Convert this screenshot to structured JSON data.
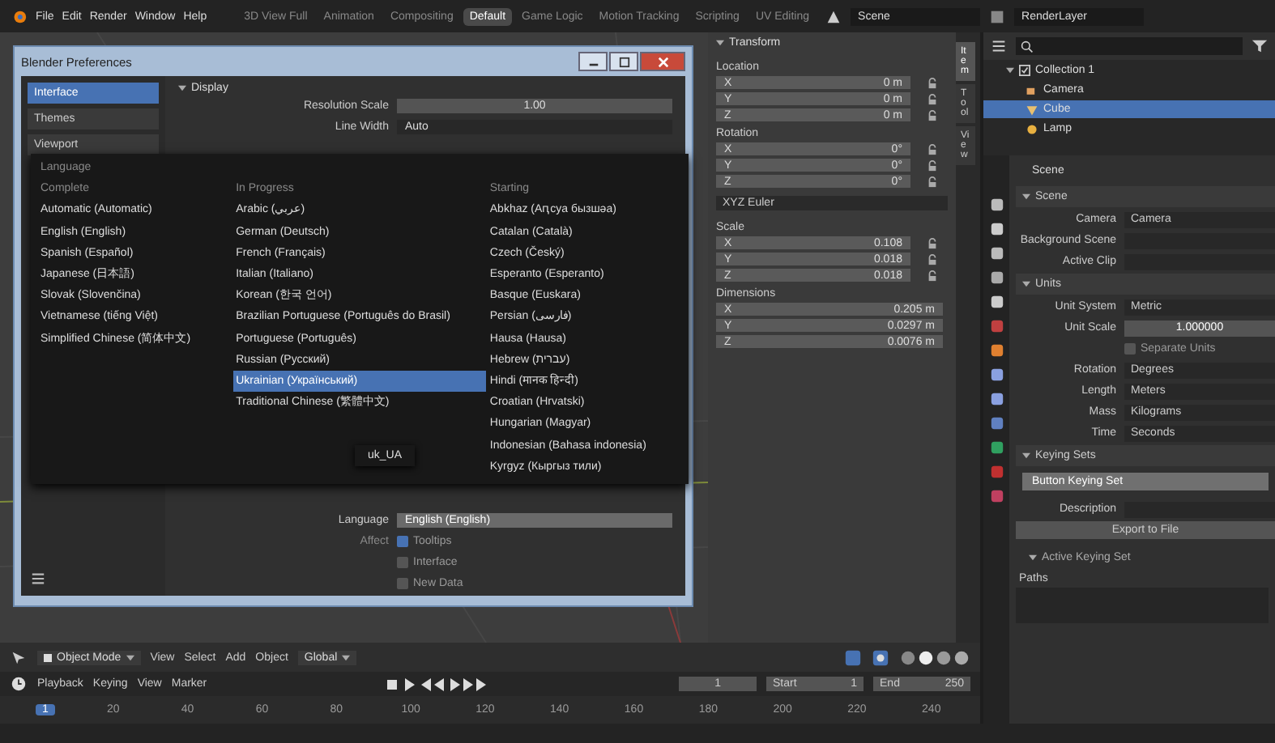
{
  "topbar": {
    "menus": [
      "File",
      "Edit",
      "Render",
      "Window",
      "Help"
    ],
    "workspaces": [
      {
        "label": "3D View Full",
        "selected": false
      },
      {
        "label": "Animation",
        "selected": false
      },
      {
        "label": "Compositing",
        "selected": false
      },
      {
        "label": "Default",
        "selected": true
      },
      {
        "label": "Game Logic",
        "selected": false
      },
      {
        "label": "Motion Tracking",
        "selected": false
      },
      {
        "label": "Scripting",
        "selected": false
      },
      {
        "label": "UV Editing",
        "selected": false
      }
    ],
    "scene": "Scene",
    "view_layer": "RenderLayer"
  },
  "preferences": {
    "title": "Blender Preferences",
    "sidebar": [
      {
        "label": "Interface",
        "selected": true
      },
      {
        "label": "Themes",
        "selected": false
      },
      {
        "label": "Viewport",
        "selected": false
      }
    ],
    "display": {
      "header": "Display",
      "fields": [
        {
          "label": "Resolution Scale",
          "value": "1.00",
          "kind": "number"
        },
        {
          "label": "Line Width",
          "value": "Auto",
          "kind": "dropdown"
        }
      ]
    },
    "language_menu": {
      "title": "Language",
      "columns": [
        {
          "heading": "Complete",
          "items": [
            {
              "label": "Automatic (Automatic)",
              "selected": false
            },
            {
              "label": "English (English)",
              "selected": false
            },
            {
              "label": "Spanish (Español)",
              "selected": false
            },
            {
              "label": "Japanese (日本語)",
              "selected": false
            },
            {
              "label": "Slovak (Slovenčina)",
              "selected": false
            },
            {
              "label": "Vietnamese (tiếng Việt)",
              "selected": false
            },
            {
              "label": "Simplified Chinese (简体中文)",
              "selected": false
            }
          ]
        },
        {
          "heading": "In Progress",
          "items": [
            {
              "label": "Arabic (عربي)",
              "selected": false
            },
            {
              "label": "German (Deutsch)",
              "selected": false
            },
            {
              "label": "French (Français)",
              "selected": false
            },
            {
              "label": "Italian (Italiano)",
              "selected": false
            },
            {
              "label": "Korean (한국 언어)",
              "selected": false
            },
            {
              "label": "Brazilian Portuguese (Português do Brasil)",
              "selected": false
            },
            {
              "label": "Portuguese (Português)",
              "selected": false
            },
            {
              "label": "Russian (Русский)",
              "selected": false
            },
            {
              "label": "Ukrainian (Український)",
              "selected": true
            },
            {
              "label": "Traditional Chinese (繁體中文)",
              "selected": false
            }
          ]
        },
        {
          "heading": "Starting",
          "items": [
            {
              "label": "Abkhaz (Аԥсуа бызшәа)",
              "selected": false
            },
            {
              "label": "Catalan (Català)",
              "selected": false
            },
            {
              "label": "Czech (Český)",
              "selected": false
            },
            {
              "label": "Esperanto (Esperanto)",
              "selected": false
            },
            {
              "label": "Basque (Euskara)",
              "selected": false
            },
            {
              "label": "Persian (فارسی)",
              "selected": false
            },
            {
              "label": "Hausa (Hausa)",
              "selected": false
            },
            {
              "label": "Hebrew (עברית)",
              "selected": false
            },
            {
              "label": "Hindi (मानक हिन्दी)",
              "selected": false
            },
            {
              "label": "Croatian (Hrvatski)",
              "selected": false
            },
            {
              "label": "Hungarian (Magyar)",
              "selected": false
            },
            {
              "label": "Indonesian (Bahasa indonesia)",
              "selected": false
            },
            {
              "label": "Kyrgyz (Кыргыз тили)",
              "selected": false
            }
          ]
        }
      ]
    },
    "tooltip": "uk_UA",
    "language": {
      "label": "Language",
      "value": "English (English)"
    },
    "affect": {
      "label": "Affect",
      "options": [
        {
          "label": "Tooltips",
          "checked": true
        },
        {
          "label": "Interface",
          "checked": false
        },
        {
          "label": "New Data",
          "checked": false
        }
      ]
    }
  },
  "sidebar_panel": {
    "title": "Transform",
    "tabs": [
      {
        "label": "Item",
        "selected": true
      },
      {
        "label": "Tool",
        "selected": false
      },
      {
        "label": "View",
        "selected": false
      }
    ],
    "groups": [
      {
        "kind": "vector",
        "label": "Location",
        "rows": [
          {
            "axis": "X",
            "value": "0 m"
          },
          {
            "axis": "Y",
            "value": "0 m"
          },
          {
            "axis": "Z",
            "value": "0 m"
          }
        ]
      },
      {
        "kind": "vector",
        "label": "Rotation",
        "rows": [
          {
            "axis": "X",
            "value": "0°"
          },
          {
            "axis": "Y",
            "value": "0°"
          },
          {
            "axis": "Z",
            "value": "0°"
          }
        ]
      },
      {
        "kind": "dropdown",
        "value": "XYZ Euler"
      },
      {
        "kind": "vector",
        "label": "Scale",
        "rows": [
          {
            "axis": "X",
            "value": "0.108"
          },
          {
            "axis": "Y",
            "value": "0.018"
          },
          {
            "axis": "Z",
            "value": "0.018"
          }
        ]
      },
      {
        "kind": "dimensions",
        "label": "Dimensions",
        "rows": [
          {
            "axis": "X",
            "value": "0.205 m"
          },
          {
            "axis": "Y",
            "value": "0.0297 m"
          },
          {
            "axis": "Z",
            "value": "0.0076 m"
          }
        ]
      }
    ]
  },
  "outliner": {
    "collection": "Collection 1",
    "items": [
      {
        "label": "Camera",
        "kind": "camera",
        "selected": false
      },
      {
        "label": "Cube",
        "kind": "mesh",
        "selected": true
      },
      {
        "label": "Lamp",
        "kind": "light",
        "selected": false
      }
    ]
  },
  "properties": {
    "context": "Scene",
    "panels": [
      {
        "title": "Scene",
        "rows": [
          {
            "kind": "field",
            "label": "Camera",
            "value": "Camera"
          },
          {
            "kind": "field",
            "label": "Background Scene"
          },
          {
            "kind": "field",
            "label": "Active Clip"
          }
        ]
      },
      {
        "title": "Units",
        "rows": [
          {
            "kind": "field",
            "label": "Unit System",
            "value": "Metric"
          },
          {
            "kind": "number",
            "label": "Unit Scale",
            "value": "1.000000"
          },
          {
            "kind": "checkbox",
            "label": "Separate Units",
            "checked": false
          },
          {
            "kind": "field",
            "label": "Rotation",
            "value": "Degrees"
          },
          {
            "kind": "field",
            "label": "Length",
            "value": "Meters"
          },
          {
            "kind": "field",
            "label": "Mass",
            "value": "Kilograms"
          },
          {
            "kind": "field",
            "label": "Time",
            "value": "Seconds"
          }
        ]
      },
      {
        "title": "Keying Sets",
        "rows": [
          {
            "kind": "list",
            "value": "Button Keying Set"
          },
          {
            "kind": "field",
            "label": "Description"
          },
          {
            "kind": "button",
            "value": "Export to File"
          },
          {
            "kind": "subpanel",
            "value": "Active Keying Set"
          },
          {
            "kind": "label",
            "value": "Paths"
          },
          {
            "kind": "list_empty"
          }
        ]
      }
    ]
  },
  "viewport_header": {
    "mode": "Object Mode",
    "menus": [
      "View",
      "Select",
      "Add",
      "Object"
    ],
    "orientation": "Global"
  },
  "timeline": {
    "menus": [
      "Playback",
      "Keying",
      "View",
      "Marker"
    ],
    "current_frame": "1",
    "start_label": "Start",
    "start": "1",
    "end_label": "End",
    "end": "250",
    "ticks": [
      {
        "label": "1",
        "selected": true
      },
      {
        "label": "20",
        "selected": false
      },
      {
        "label": "40",
        "selected": false
      },
      {
        "label": "60",
        "selected": false
      },
      {
        "label": "80",
        "selected": false
      },
      {
        "label": "100",
        "selected": false
      },
      {
        "label": "120",
        "selected": false
      },
      {
        "label": "140",
        "selected": false
      },
      {
        "label": "160",
        "selected": false
      },
      {
        "label": "180",
        "selected": false
      },
      {
        "label": "200",
        "selected": false
      },
      {
        "label": "220",
        "selected": false
      },
      {
        "label": "240",
        "selected": false
      }
    ]
  }
}
